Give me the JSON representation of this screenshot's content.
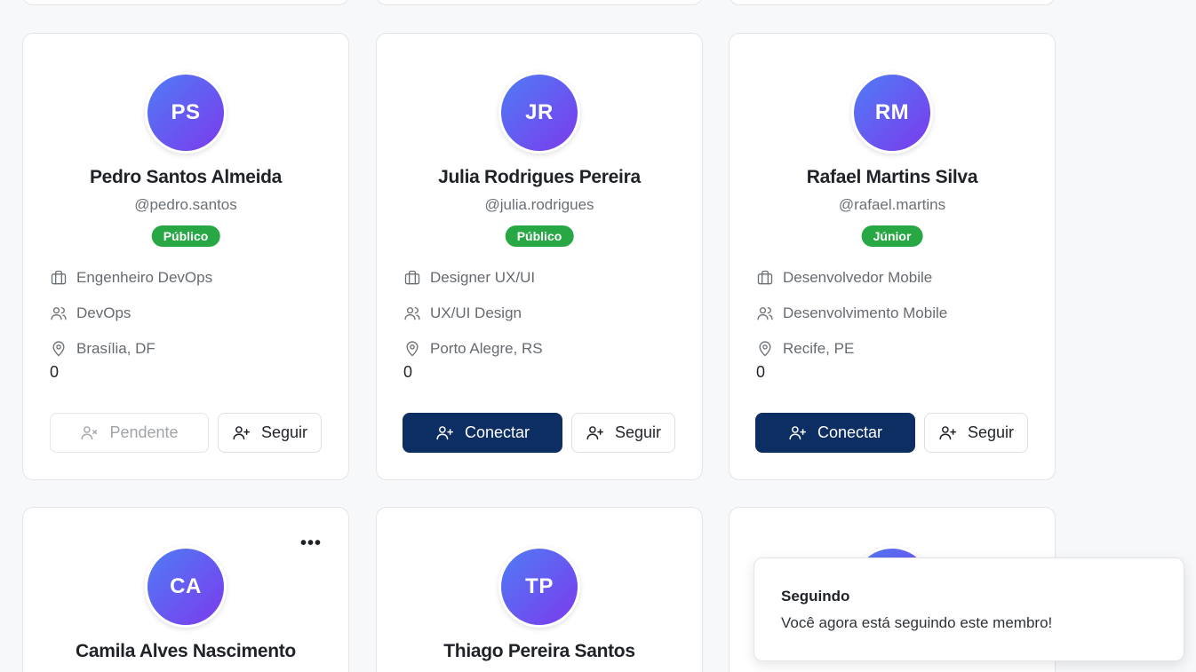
{
  "cards_mid": [
    {
      "initials": "PS",
      "name": "Pedro Santos Almeida",
      "handle": "@pedro.santos",
      "badge": "Público",
      "role": "Engenheiro DevOps",
      "team": "DevOps",
      "location": "Brasília, DF",
      "count": "0",
      "connect_state": "pending",
      "connect_label": "Pendente",
      "follow_label": "Seguir"
    },
    {
      "initials": "JR",
      "name": "Julia Rodrigues Pereira",
      "handle": "@julia.rodrigues",
      "badge": "Público",
      "role": "Designer UX/UI",
      "team": "UX/UI Design",
      "location": "Porto Alegre, RS",
      "count": "0",
      "connect_state": "connect",
      "connect_label": "Conectar",
      "follow_label": "Seguir"
    },
    {
      "initials": "RM",
      "name": "Rafael Martins Silva",
      "handle": "@rafael.martins",
      "badge": "Júnior",
      "role": "Desenvolvedor Mobile",
      "team": "Desenvolvimento Mobile",
      "location": "Recife, PE",
      "count": "0",
      "connect_state": "connect",
      "connect_label": "Conectar",
      "follow_label": "Seguir"
    }
  ],
  "cards_bottom": [
    {
      "initials": "CA",
      "name": "Camila Alves Nascimento",
      "menu": "•••"
    },
    {
      "initials": "TP",
      "name": "Thiago Pereira Santos"
    },
    {
      "initials": "",
      "name": ""
    }
  ],
  "toast": {
    "title": "Seguindo",
    "message": "Você agora está seguindo este membro!"
  },
  "colors": {
    "primary": "#0d2e63",
    "badge_green": "#28a745",
    "avatar_from": "#4f7cf5",
    "avatar_to": "#7c3aed"
  }
}
